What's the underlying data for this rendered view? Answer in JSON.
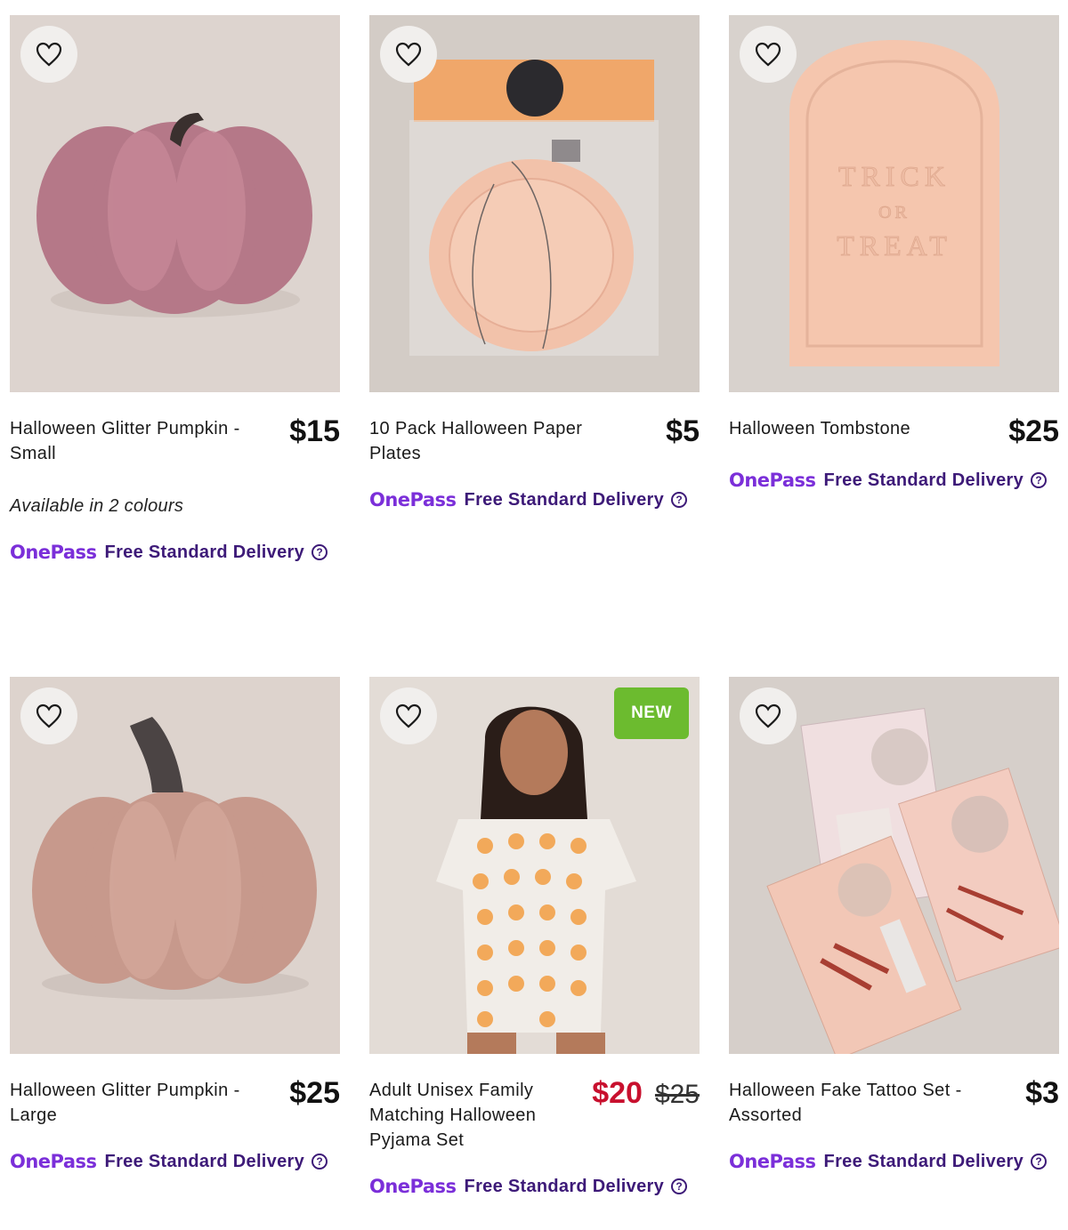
{
  "products": [
    {
      "title": "Halloween Glitter Pumpkin - Small",
      "price": "$15",
      "colours": "Available in 2 colours",
      "onepass": "OnePass",
      "delivery": "Free Standard Delivery",
      "image_icon": "pink-glitter-pumpkin-small"
    },
    {
      "title": "10 Pack Halloween Paper Plates",
      "price": "$5",
      "onepass": "OnePass",
      "delivery": "Free Standard Delivery",
      "image_icon": "pumpkin-paper-plates"
    },
    {
      "title": "Halloween Tombstone",
      "price": "$25",
      "onepass": "OnePass",
      "delivery": "Free Standard Delivery",
      "image_icon": "tombstone",
      "tombstone_text": [
        "TRICK",
        "OR",
        "TREAT"
      ]
    },
    {
      "title": "Halloween Glitter Pumpkin - Large",
      "price": "$25",
      "onepass": "OnePass",
      "delivery": "Free Standard Delivery",
      "image_icon": "rose-glitter-pumpkin-large"
    },
    {
      "title": "Adult Unisex Family Matching Halloween Pyjama Set",
      "price_sale": "$20",
      "price_old": "$25",
      "badge": "NEW",
      "onepass": "OnePass",
      "delivery": "Free Standard Delivery",
      "image_icon": "woman-pumpkin-pyjamas"
    },
    {
      "title": "Halloween Fake Tattoo Set - Assorted",
      "price": "$3",
      "onepass": "OnePass",
      "delivery": "Free Standard Delivery",
      "image_icon": "fake-tattoo-packs"
    }
  ],
  "colors": {
    "onepass_purple": "#7b2fd9",
    "delivery_text": "#3d1a78",
    "sale_red": "#c8102e",
    "new_badge_green": "#6cbb2f"
  }
}
